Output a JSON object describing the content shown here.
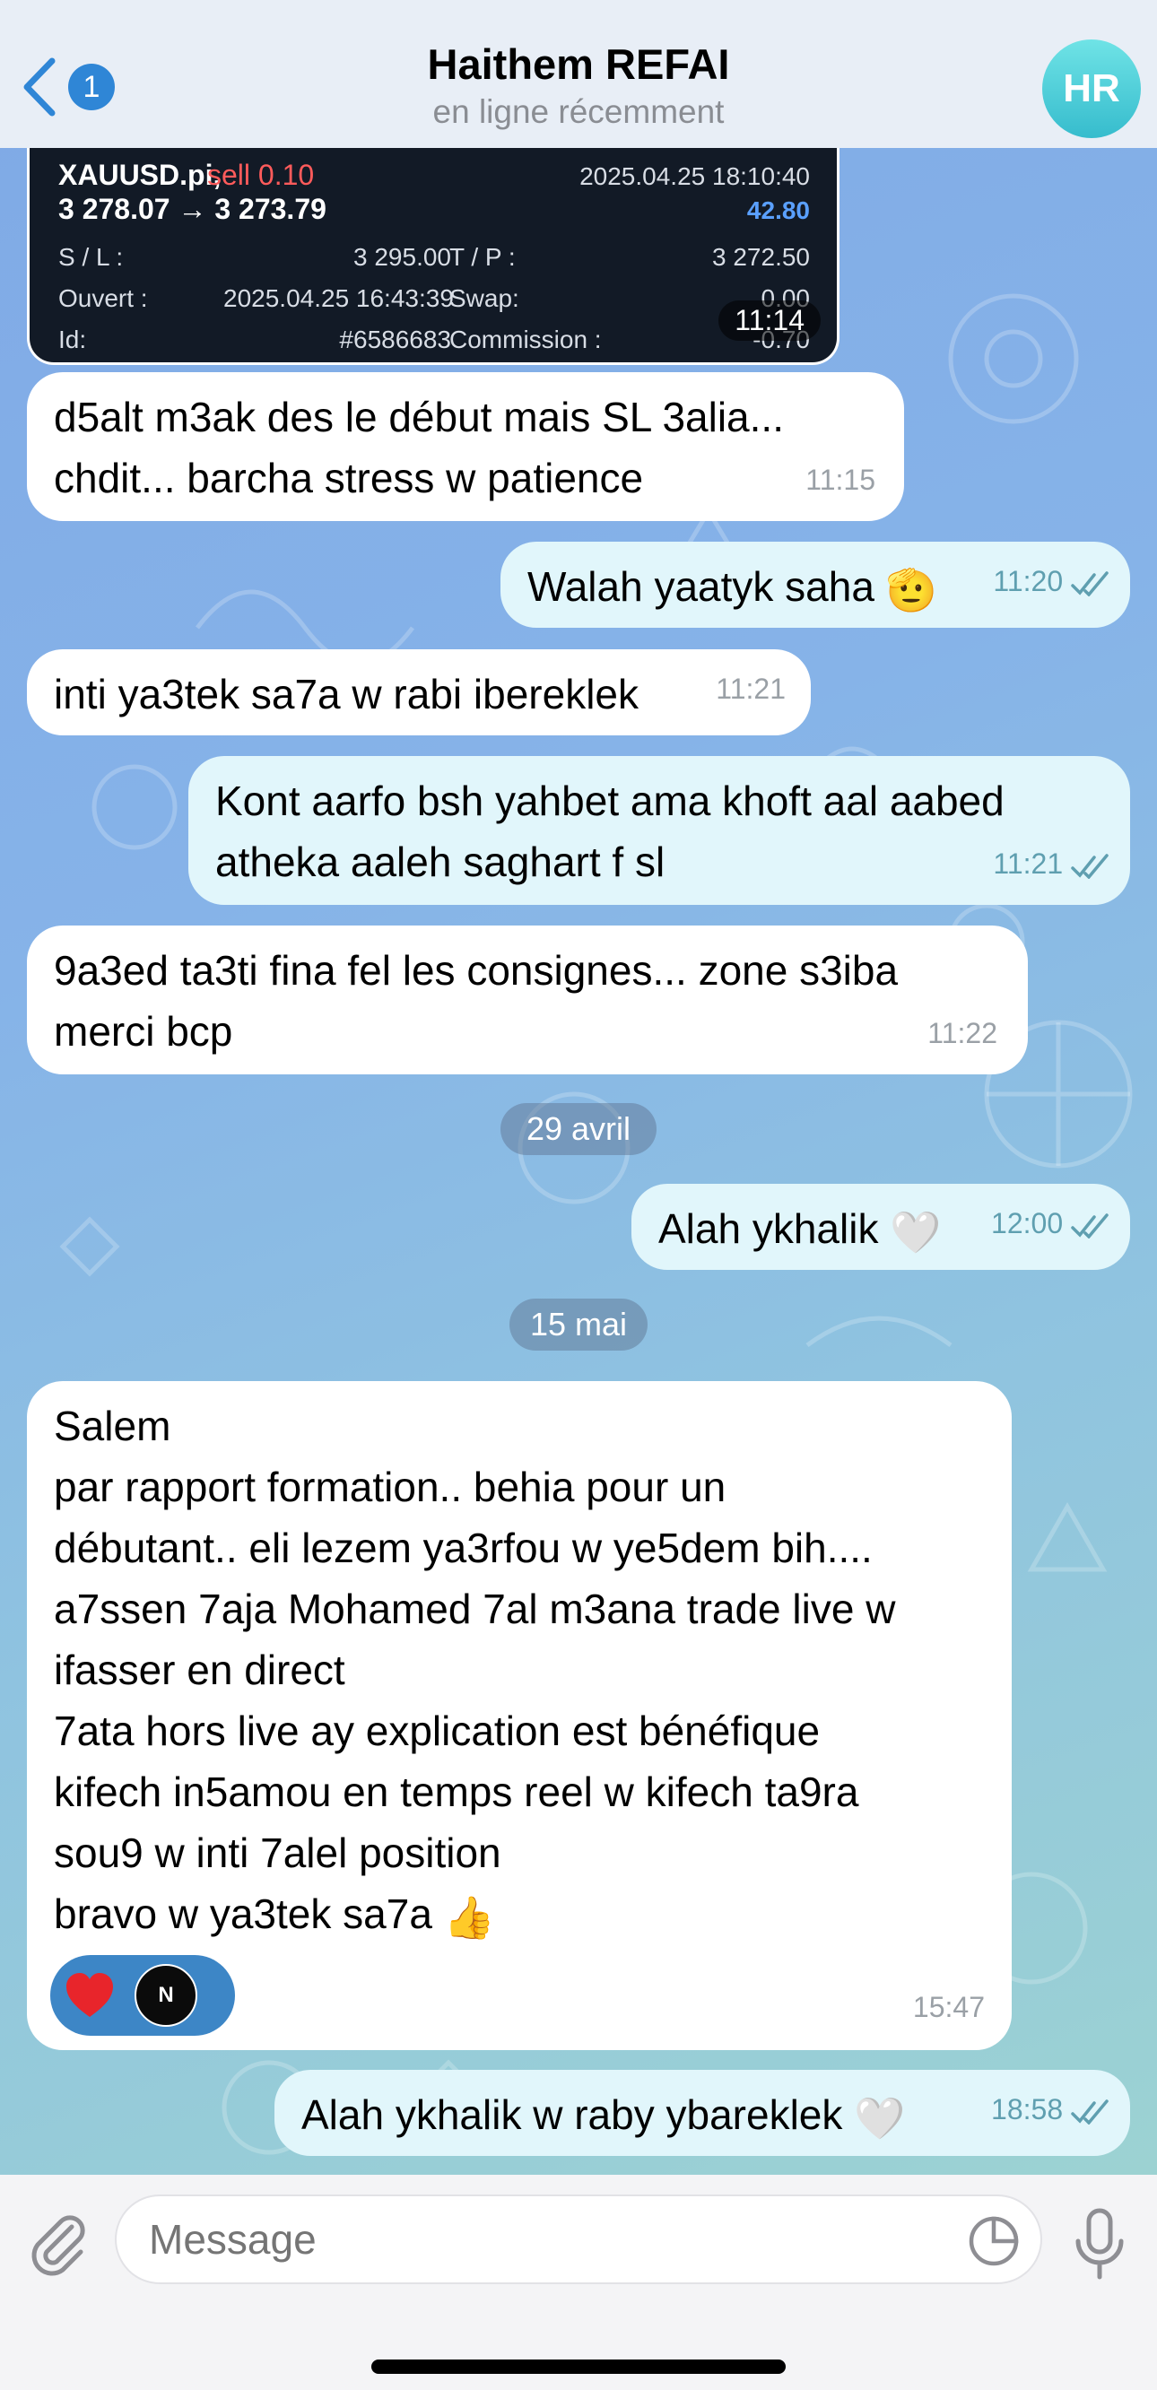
{
  "header": {
    "back_count": "1",
    "title": "Haithem REFAI",
    "status": "en ligne récemment",
    "avatar_initials": "HR"
  },
  "trade_card": {
    "symbol": "XAUUSD.pi,",
    "side": "sell 0.10",
    "datetime": "2025.04.25 18:10:40",
    "prices": "3 278.07 → 3 273.79",
    "profit": "42.80",
    "sl_label": "S / L :",
    "sl_value": "3 295.00",
    "tp_label": "T / P :",
    "tp_value": "3 272.50",
    "open_label": "Ouvert :",
    "open_value": "2025.04.25 16:43:39",
    "swap_label": "Swap:",
    "swap_value": "0.00",
    "id_label": "Id:",
    "id_value": "#6586683",
    "commission_label": "Commission :",
    "commission_value": "-0.70",
    "time": "11:14"
  },
  "messages": [
    {
      "dir": "in",
      "lines": [
        "d5alt m3ak des le début mais SL 3alia...",
        "chdit... barcha stress w patience"
      ],
      "time": "11:15"
    },
    {
      "dir": "out",
      "lines": [
        "Walah yaatyk saha"
      ],
      "emoji": "🫡",
      "time": "11:20"
    },
    {
      "dir": "in",
      "lines": [
        "inti ya3tek sa7a w rabi ibereklek"
      ],
      "time": "11:21"
    },
    {
      "dir": "out",
      "lines": [
        "Kont aarfo bsh yahbet ama khoft aal aabed",
        "atheka aaleh saghart f sl"
      ],
      "time": "11:21"
    },
    {
      "dir": "in",
      "lines": [
        "9a3ed ta3ti fina fel les consignes... zone s3iba",
        "merci bcp"
      ],
      "time": "11:22"
    },
    {
      "dir": "out",
      "lines": [
        "Alah ykhalik"
      ],
      "emoji": "🤍",
      "time": "12:00"
    },
    {
      "dir": "in",
      "lines": [
        "Salem",
        "par rapport formation.. behia pour un",
        "débutant.. eli lezem ya3rfou w ye5dem bih....",
        "a7ssen 7aja Mohamed 7al m3ana trade live w",
        "ifasser en direct",
        "7ata hors live ay explication est bénéfique",
        "kifech in5amou en temps reel w kifech ta9ra",
        "sou9 w inti 7alel position",
        "bravo w ya3tek sa7a"
      ],
      "emoji": "👍",
      "time": "15:47"
    },
    {
      "dir": "out",
      "lines": [
        "Alah ykhalik w raby ybareklek"
      ],
      "emoji": "🤍",
      "time": "18:58"
    }
  ],
  "dates": [
    "29 avril",
    "15 mai"
  ],
  "reactions": {
    "avatar_label": "N"
  },
  "composer": {
    "placeholder": "Message"
  }
}
